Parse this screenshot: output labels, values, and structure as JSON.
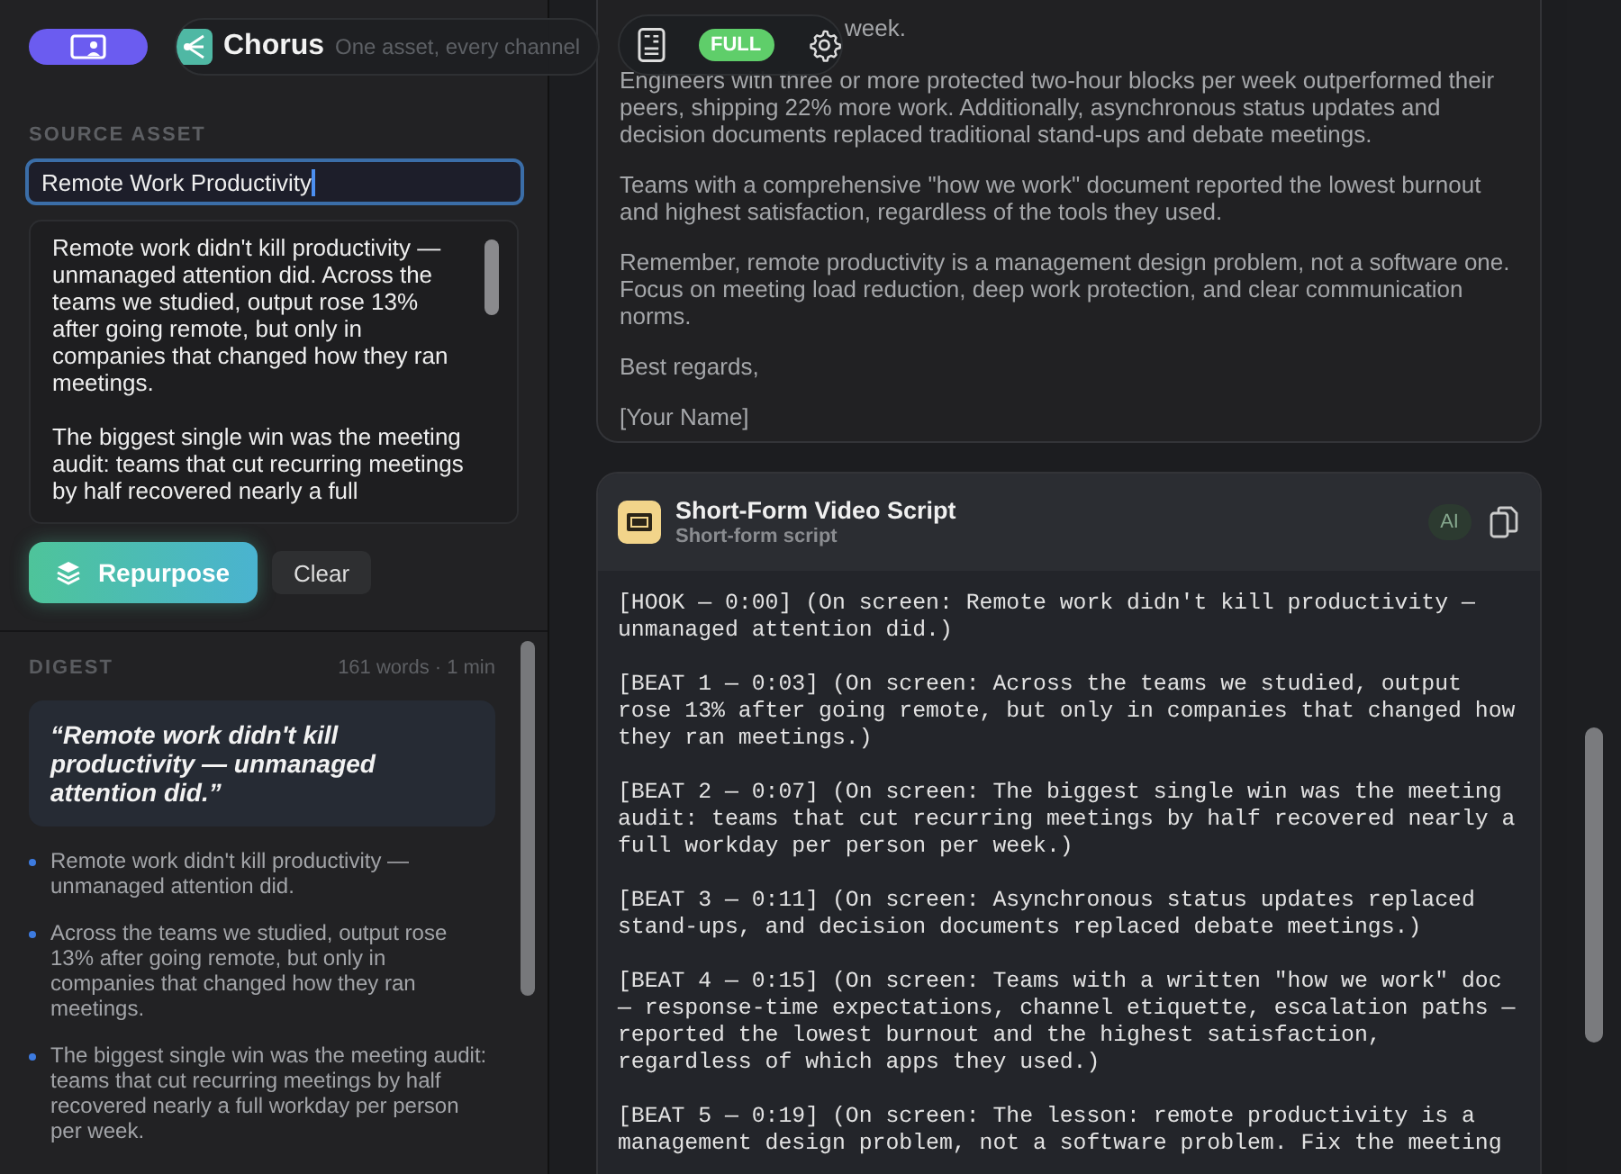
{
  "toolbar": {
    "app_name": "Chorus",
    "tagline": "One asset, every channel",
    "mode_badge": "FULL"
  },
  "source": {
    "label": "SOURCE ASSET",
    "title": "Remote Work Productivity",
    "body": [
      "Remote work didn't kill productivity — unmanaged attention did. Across the teams we studied, output rose 13% after going remote, but only in companies that changed how they ran meetings.",
      "The biggest single win was the meeting audit: teams that cut recurring meetings by half recovered nearly a full"
    ]
  },
  "actions": [
    {
      "label": "Repurpose",
      "kind": "primary"
    },
    {
      "label": "Clear",
      "kind": "secondary"
    }
  ],
  "digest": {
    "label": "DIGEST",
    "stats": "161 words · 1 min",
    "quote": "“Remote work didn't kill productivity — unmanaged attention did.”",
    "points": [
      "Remote work didn't kill productivity — unmanaged attention did.",
      "Across the teams we studied, output rose 13% after going remote, but only in companies that changed how they ran meetings.",
      "The biggest single win was the meeting audit: teams that cut recurring meetings by half recovered nearly a full workday per person per week."
    ]
  },
  "email_card": {
    "top_lines": [
      "week."
    ],
    "paragraphs": [
      "Engineers with three or more protected two-hour blocks per week outperformed their peers, shipping 22% more work. Additionally, asynchronous status updates and decision documents replaced traditional stand-ups and debate meetings.",
      "Teams with a comprehensive \"how we work\" document reported the lowest burnout and highest satisfaction, regardless of the tools they used.",
      "Remember, remote productivity is a management design problem, not a software one. Focus on meeting load reduction, deep work protection, and clear communication norms.",
      "Best regards,",
      "[Your Name]"
    ]
  },
  "script_card": {
    "title": "Short-Form Video Script",
    "subtitle": "Short-form script",
    "badge": "AI",
    "beats": [
      "[HOOK — 0:00] (On screen: Remote work didn't kill productivity — unmanaged attention did.)",
      "[BEAT 1 — 0:03] (On screen: Across the teams we studied, output rose 13% after going remote, but only in companies that changed how they ran meetings.)",
      "[BEAT 2 — 0:07] (On screen: The biggest single win was the meeting audit: teams that cut recurring meetings by half recovered nearly a full workday per person per week.)",
      "[BEAT 3 — 0:11] (On screen: Asynchronous status updates replaced stand-ups, and decision documents replaced debate meetings.)",
      "[BEAT 4 — 0:15] (On screen: Teams with a written \"how we work\" doc — response-time expectations, channel etiquette, escalation paths — reported the lowest burnout and the highest satisfaction, regardless of which apps they used.)",
      "[BEAT 5 — 0:19] (On screen: The lesson: remote productivity is a management design problem, not a software problem. Fix the meeting"
    ]
  }
}
